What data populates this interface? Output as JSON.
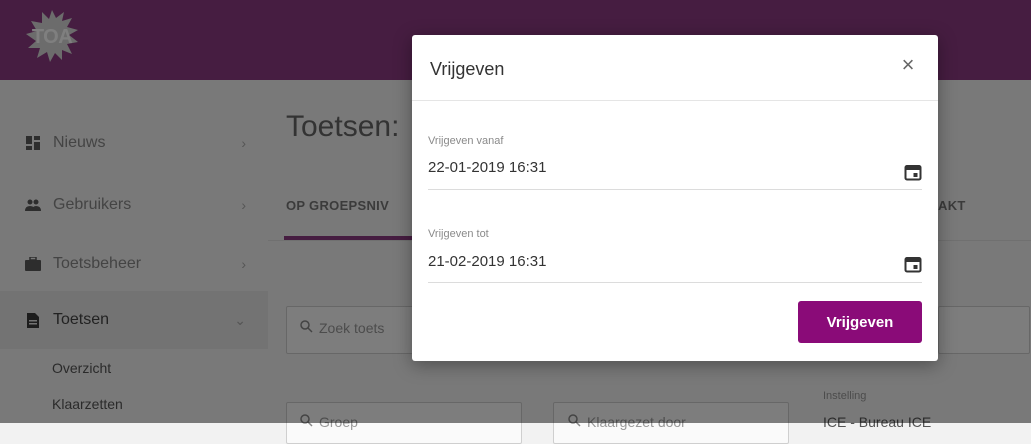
{
  "app": {
    "logo_text": "TOA"
  },
  "sidebar": {
    "items": [
      {
        "label": "Nieuws",
        "icon": "dashboard-icon"
      },
      {
        "label": "Gebruikers",
        "icon": "users-icon"
      },
      {
        "label": "Toetsbeheer",
        "icon": "briefcase-icon"
      },
      {
        "label": "Toetsen",
        "icon": "document-icon"
      }
    ],
    "subitems": [
      "Overzicht",
      "Klaarzetten"
    ]
  },
  "main": {
    "title": "Toetsen:",
    "tabs": [
      {
        "label": "OP GROEPSNIV"
      },
      {
        "label": "AKT"
      }
    ],
    "search_placeholder": "Zoek toets",
    "groep_placeholder": "Groep",
    "klaargezet_placeholder": "Klaargezet door",
    "instelling": {
      "label": "Instelling",
      "value": "ICE - Bureau ICE"
    }
  },
  "modal": {
    "title": "Vrijgeven",
    "close_label": "×",
    "from": {
      "label": "Vrijgeven vanaf",
      "value": "22-01-2019 16:31"
    },
    "to": {
      "label": "Vrijgeven tot",
      "value": "21-02-2019 16:31"
    },
    "submit_label": "Vrijgeven"
  },
  "colors": {
    "brand": "#8c3b82",
    "button": "#8a0b78"
  }
}
